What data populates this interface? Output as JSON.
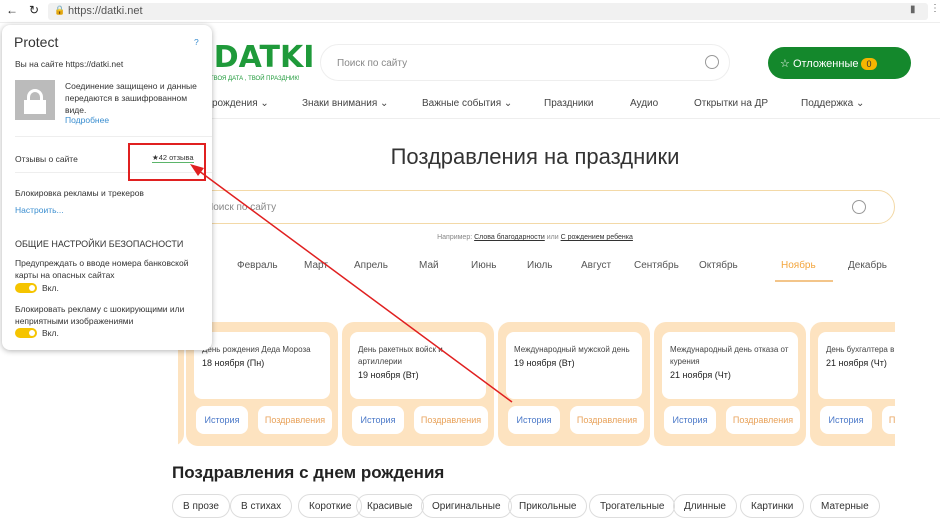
{
  "browser": {
    "url": "https://datki.net"
  },
  "site": {
    "logo": "DATKI",
    "logo_tagline": "ТВОЯ ДАТА , ТВОЙ ПРАЗДНИК!",
    "logo_top": "Поздравляет!",
    "search_placeholder": "Поиск по сайту",
    "favorites_label": "Отложенные",
    "favorites_count": "0",
    "nav": [
      {
        "label": "рождения",
        "dropdown": true
      },
      {
        "label": "Знаки внимания",
        "dropdown": true
      },
      {
        "label": "Важные события",
        "dropdown": true
      },
      {
        "label": "Праздники"
      },
      {
        "label": "Аудио"
      },
      {
        "label": "Открытки на ДР"
      },
      {
        "label": "Поддержка",
        "dropdown": true
      }
    ],
    "page_title": "Поздравления на праздники",
    "main_search_placeholder": "Поиск по сайту",
    "example_prefix": "Например:",
    "example_link1": "Слова благодарности",
    "example_or": "или",
    "example_link2": "С рождением ребенка",
    "months": [
      "Февраль",
      "Март",
      "Апрель",
      "Май",
      "Июнь",
      "Июль",
      "Август",
      "Сентябрь",
      "Октябрь",
      "Ноябрь",
      "Декабрь"
    ],
    "active_month": "Ноябрь",
    "cards": [
      {
        "name": "День рождения Деда Мороза",
        "date": "18 ноября (Пн)"
      },
      {
        "name": "День ракетных войск и артиллерии",
        "date": "19 ноября (Вт)"
      },
      {
        "name": "Международный мужской день",
        "date": "19 ноября (Вт)"
      },
      {
        "name": "Международный день отказа от курения",
        "date": "21 ноября (Чт)"
      },
      {
        "name": "День бухгалтера в России",
        "date": "21 ноября (Чт)"
      }
    ],
    "card_btn_history": "История",
    "card_btn_greetings": "Поздравления",
    "section_title": "Поздравления с днем рождения",
    "chips": [
      "В прозе",
      "В стихах",
      "Короткие",
      "Красивые",
      "Оригинальные",
      "Прикольные",
      "Трогательные",
      "Длинные",
      "Картинки",
      "Матерные"
    ]
  },
  "popup": {
    "title": "Protect",
    "help": "?",
    "site_line": "Вы на сайте https://datki.net",
    "secure_text": "Соединение защищено и данные передаются в зашифрованном виде.",
    "more_link": "Подробнее",
    "reviews_label": "Отзывы о сайте",
    "reviews_value": "42 отзыва",
    "adblock_label": "Блокировка рекламы и трекеров",
    "configure_link": "Настроить...",
    "general_heading": "ОБЩИЕ НАСТРОЙКИ БЕЗОПАСНОСТИ",
    "setting1": "Предупреждать о вводе номера банковской карты на опасных сайтах",
    "setting1_state": "Вкл.",
    "setting2": "Блокировать рекламу с шокирующими или неприятными изображениями",
    "setting2_state": "Вкл."
  },
  "colors": {
    "brand_green": "#14882c",
    "accent_orange": "#f39a1e",
    "card_bg": "#fde3c0",
    "annotation_red": "#e02020",
    "toggle": "#f5c400"
  }
}
